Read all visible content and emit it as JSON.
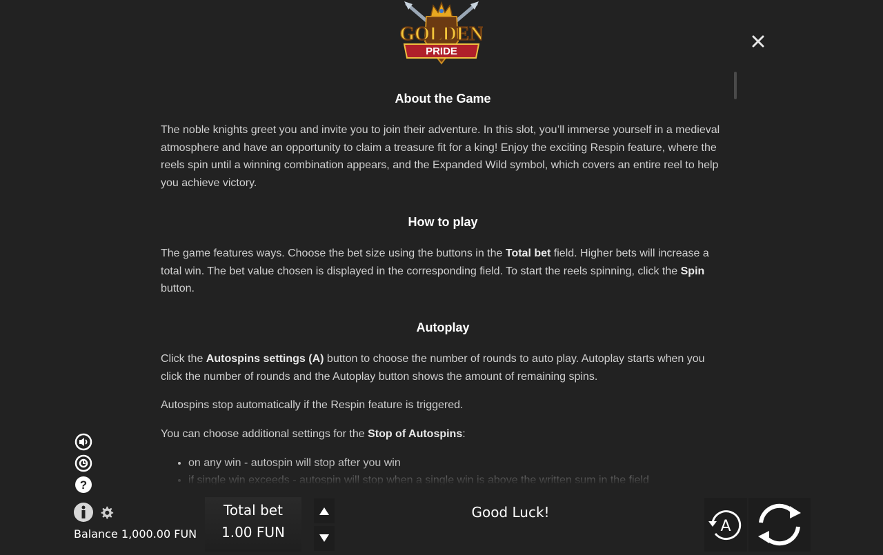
{
  "logo": {
    "line1": "GOLDEN",
    "line2": "PRIDE"
  },
  "icons": {
    "close": "close-icon",
    "sound": "sound-icon",
    "history": "history-icon",
    "help": "help-icon",
    "info": "info-icon",
    "settings": "gear-icon",
    "bet_up": "arrow-up-icon",
    "bet_down": "arrow-down-icon",
    "autospin": "autospin-icon",
    "spin": "spin-icon"
  },
  "rules": {
    "about": {
      "title": "About the Game",
      "text": "The noble knights greet you and invite you to join their adventure. In this slot, you’ll immerse yourself in a medieval atmosphere and have an opportunity to claim a treasure fit for a king! Enjoy the exciting Respin feature, where the reels spin until a winning combination appears, and the Expanded Wild symbol, which covers an entire reel to help you achieve victory."
    },
    "how_to_play": {
      "title": "How to play",
      "text_a": "The game features ways. Choose the bet size using the buttons in the ",
      "bold_a": "Total bet",
      "text_b": " field. Higher bets will increase a total win. The bet value chosen is displayed in the corresponding field. To start the reels spinning, click the ",
      "bold_b": "Spin",
      "text_c": " button."
    },
    "autoplay": {
      "title": "Autoplay",
      "p1_a": "Click the ",
      "p1_bold": "Autospins settings (A)",
      "p1_b": " button to choose the number of rounds to auto play. Autoplay starts when you click the number of rounds and the Autoplay button shows the amount of remaining spins.",
      "p2": "Autospins stop automatically if the Respin feature is triggered.",
      "p3_a": "You can choose additional settings for the ",
      "p3_bold": "Stop of Autospins",
      "p3_b": ":",
      "list": [
        "on any win - autospin will stop after you win",
        "if single win exceeds - autospin will stop when a single win is above the written sum in the field"
      ]
    }
  },
  "footer": {
    "balance": "Balance 1,000.00 FUN",
    "bet_label": "Total bet",
    "bet_value": "1.00 FUN",
    "message": "Good Luck!",
    "auto_label": "A"
  },
  "colors": {
    "background": "#222222",
    "text": "#cfcfcf",
    "heading": "#ffffff",
    "logo_gold": "#e8a820",
    "logo_red": "#b0202a"
  }
}
